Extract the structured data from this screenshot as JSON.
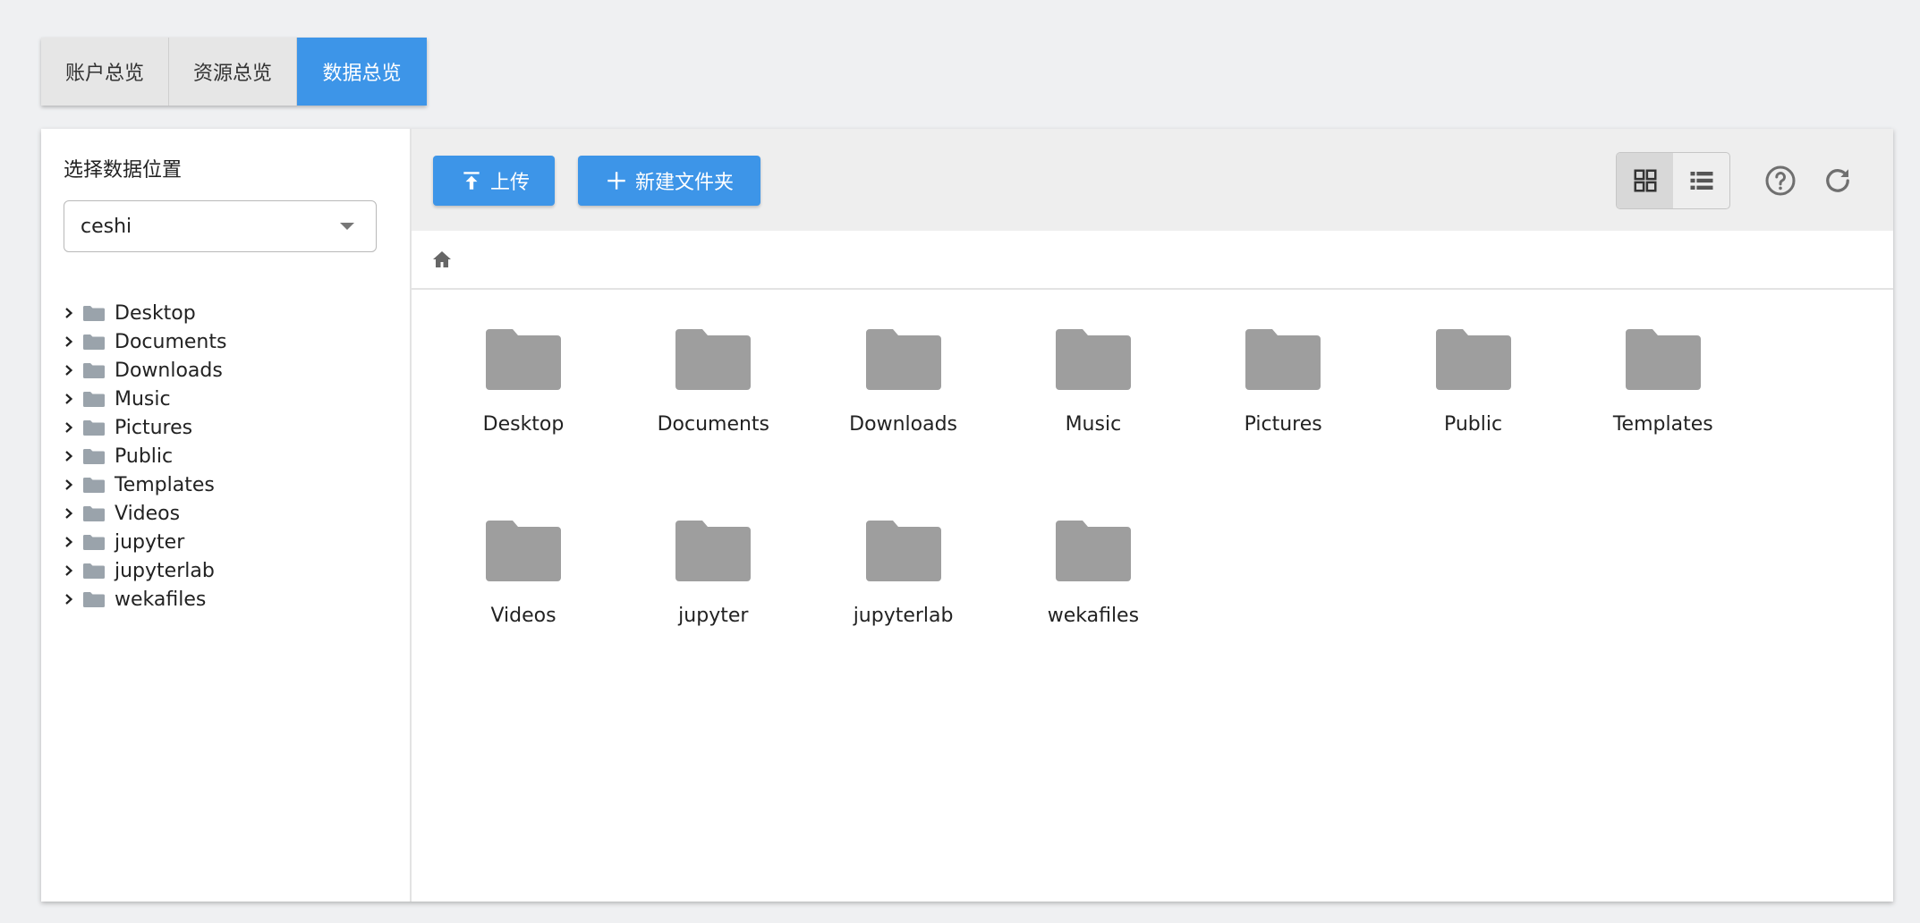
{
  "tabs": [
    "账户总览",
    "资源总览",
    "数据总览"
  ],
  "sidebar": {
    "title": "选择数据位置",
    "select_value": "ceshi",
    "tree": [
      "Desktop",
      "Documents",
      "Downloads",
      "Music",
      "Pictures",
      "Public",
      "Templates",
      "Videos",
      "jupyter",
      "jupyterlab",
      "wekafiles"
    ]
  },
  "toolbar": {
    "upload_label": "上传",
    "new_folder_label": "新建文件夹"
  },
  "grid": {
    "folders": [
      "Desktop",
      "Documents",
      "Downloads",
      "Music",
      "Pictures",
      "Public",
      "Templates",
      "Videos",
      "jupyter",
      "jupyterlab",
      "wekafiles"
    ]
  },
  "colors": {
    "accent": "#3d95e8",
    "folder_gray": "#9e9e9e",
    "tree_folder": "#9aa3ab"
  },
  "icons": [
    "upload-icon",
    "plus-icon",
    "grid-view-icon",
    "list-view-icon",
    "help-icon",
    "refresh-icon",
    "home-icon",
    "folder-icon",
    "chevron-right-icon",
    "caret-down-icon"
  ]
}
